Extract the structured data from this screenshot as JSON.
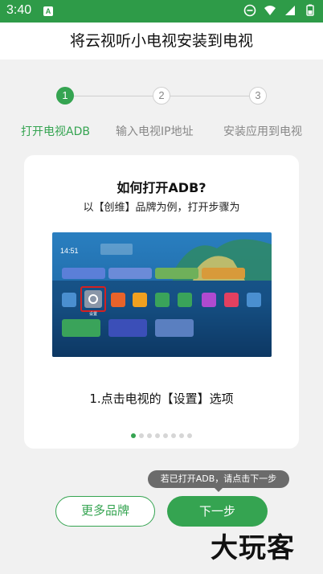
{
  "status_bar": {
    "time": "3:40",
    "notification_badge": "A",
    "icons": [
      "dnd-icon",
      "wifi-icon",
      "signal-icon",
      "battery-icon"
    ]
  },
  "header": {
    "title": "将云视听小电视安装到电视"
  },
  "stepper": {
    "steps": [
      {
        "number": "1",
        "label": "打开电视ADB",
        "state": "active"
      },
      {
        "number": "2",
        "label": "输入电视IP地址",
        "state": "todo"
      },
      {
        "number": "3",
        "label": "安装应用到电视",
        "state": "todo"
      }
    ],
    "active_color": "#35a451"
  },
  "card": {
    "title": "如何打开ADB?",
    "subtitle": "以【创维】品牌为例，打开步骤为",
    "caption": "1.点击电视的【设置】选项",
    "screenshot": {
      "tv_time": "14:51",
      "settings_label": "设置"
    },
    "pagination": {
      "total": 8,
      "current": 1
    }
  },
  "tooltip": {
    "text": "若已打开ADB，请点击下一步"
  },
  "buttons": {
    "more_brands": "更多品牌",
    "next": "下一步"
  },
  "watermark": "大玩客"
}
